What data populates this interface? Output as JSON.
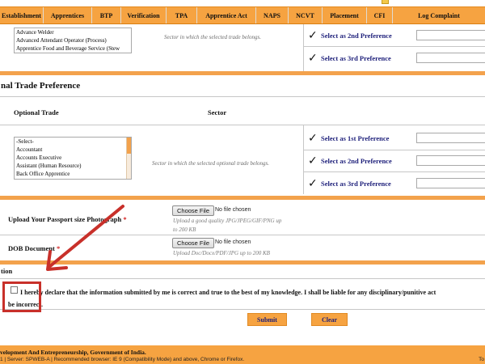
{
  "nav": {
    "items": [
      "Establishment",
      "Apprentices",
      "BTP",
      "Verification",
      "TPA",
      "Apprentice Act",
      "NAPS",
      "NCVT",
      "Placement",
      "CFI",
      "Log Complaint"
    ]
  },
  "trade_section": {
    "listbox_options": [
      "Advance Welder",
      "Advanced Attendant Operator (Process)",
      "Apprentice Food and Beverage Service (Stew"
    ],
    "sector_hint": "Sector in which the selected trade belongs.",
    "pref2_label": "Select as 2nd Preference",
    "pref3_label": "Select as 3rd Preference"
  },
  "optional_section": {
    "title": "nal Trade Preference",
    "col_trade": "Optional Trade",
    "col_sector": "Sector",
    "listbox_options": [
      "-Select-",
      "Accountant",
      "Accounts Executive",
      "Assistant (Human Resource)",
      "Back Office Apprentice"
    ],
    "sector_hint": "Sector in which the selected optional trade belongs.",
    "pref1_label": "Select as 1st Preference",
    "pref2_label": "Select as 2nd Preference",
    "pref3_label": "Select as 3rd Preference"
  },
  "uploads": {
    "photo_label": "Upload Your Passport size Photograph",
    "photo_required": "*",
    "photo_button": "Choose File",
    "photo_status": "No file chosen",
    "photo_help_1": "Upload a good quality JPG/JPEG/GIF/PNG up",
    "photo_help_2": "to 200 KB",
    "dob_label": "DOB Document",
    "dob_required": "*",
    "dob_button": "Choose File",
    "dob_status": "No file chosen",
    "dob_help": "Upload Doc/Docx/PDF/JPG up to 200 KB"
  },
  "declaration": {
    "section_fragment": "tion",
    "line1": "I hereby declare that the information submitted by me is correct and true to the best of my knowledge. I shall be liable for any disciplinary/punitive act",
    "line2": "be incorrect."
  },
  "buttons": {
    "submit": "Submit",
    "clear": "Clear"
  },
  "footer": {
    "line1": "velopment And Entrepreneurship, Government of India.",
    "line2": "1 | Server: SPWEB-A | Recommended browser: IE 9 (Compatibility Mode) and above, Chrome or Firefox.",
    "right": "To"
  },
  "colors": {
    "nav_orange": "#f6a341",
    "pref_label": "#1d1f7a",
    "annotation_red": "#c8302a"
  }
}
